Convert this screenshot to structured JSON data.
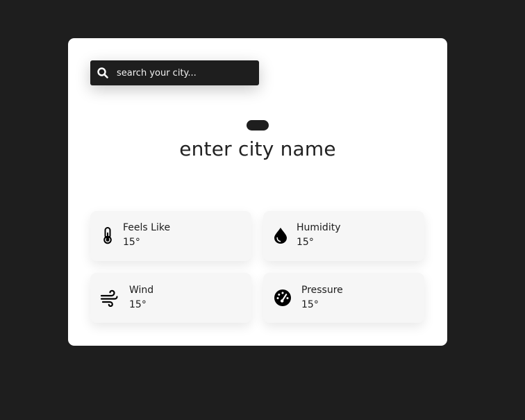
{
  "search": {
    "placeholder": "search your city...",
    "icon": "search-icon"
  },
  "weather": {
    "icon": "weather-icon",
    "city_name": "enter city name"
  },
  "stats": {
    "feels_like": {
      "label": "Feels Like",
      "value": "15°",
      "icon": "thermometer-icon"
    },
    "humidity": {
      "label": "Humidity",
      "value": "15°",
      "icon": "droplet-icon"
    },
    "wind": {
      "label": "Wind",
      "value": "15°",
      "icon": "wind-icon"
    },
    "pressure": {
      "label": "Pressure",
      "value": "15°",
      "icon": "gauge-icon"
    }
  },
  "colors": {
    "background": "#1e1e1e",
    "card": "#ffffff",
    "tile": "#f6f6f6",
    "text": "#1b1b1b"
  }
}
